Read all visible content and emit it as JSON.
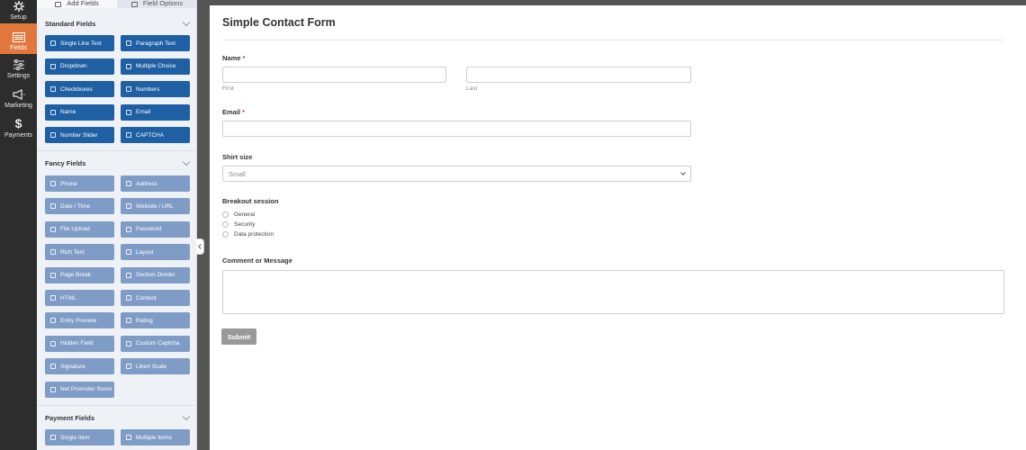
{
  "nav": [
    {
      "label": "Setup",
      "icon": "gear-icon"
    },
    {
      "label": "Fields",
      "icon": "fields-icon"
    },
    {
      "label": "Settings",
      "icon": "sliders-icon"
    },
    {
      "label": "Marketing",
      "icon": "megaphone-icon"
    },
    {
      "label": "Payments",
      "icon": "dollar-icon"
    }
  ],
  "tabs": {
    "add_fields": "Add Fields",
    "field_options": "Field Options"
  },
  "sections": {
    "standard": "Standard Fields",
    "fancy": "Fancy Fields",
    "payment": "Payment Fields"
  },
  "standard_fields": [
    "Single Line Text",
    "Paragraph Text",
    "Dropdown",
    "Multiple Choice",
    "Checkboxes",
    "Numbers",
    "Name",
    "Email",
    "Number Slider",
    "CAPTCHA"
  ],
  "fancy_fields": [
    "Phone",
    "Address",
    "Date / Time",
    "Website / URL",
    "File Upload",
    "Password",
    "Rich Text",
    "Layout",
    "Page Break",
    "Section Divider",
    "HTML",
    "Content",
    "Entry Preview",
    "Rating",
    "Hidden Field",
    "Custom Captcha",
    "Signature",
    "Likert Scale",
    "Net Promoter Score"
  ],
  "payment_fields": [
    "Single Item",
    "Multiple Items"
  ],
  "form": {
    "title": "Simple Contact Form",
    "name_label": "Name",
    "required_mark": "*",
    "first_sub": "First",
    "last_sub": "Last",
    "email_label": "Email",
    "shirt_label": "Shirt size",
    "shirt_value": "Small",
    "breakout_label": "Breakout session",
    "breakout_options": [
      "General",
      "Security",
      "Data protection"
    ],
    "comment_label": "Comment or Message",
    "submit_label": "Submit"
  },
  "colors": {
    "accent": "#e0783d",
    "standard_button": "#1f5fa3",
    "fancy_button": "#7f9cc7",
    "required": "#d63638"
  }
}
